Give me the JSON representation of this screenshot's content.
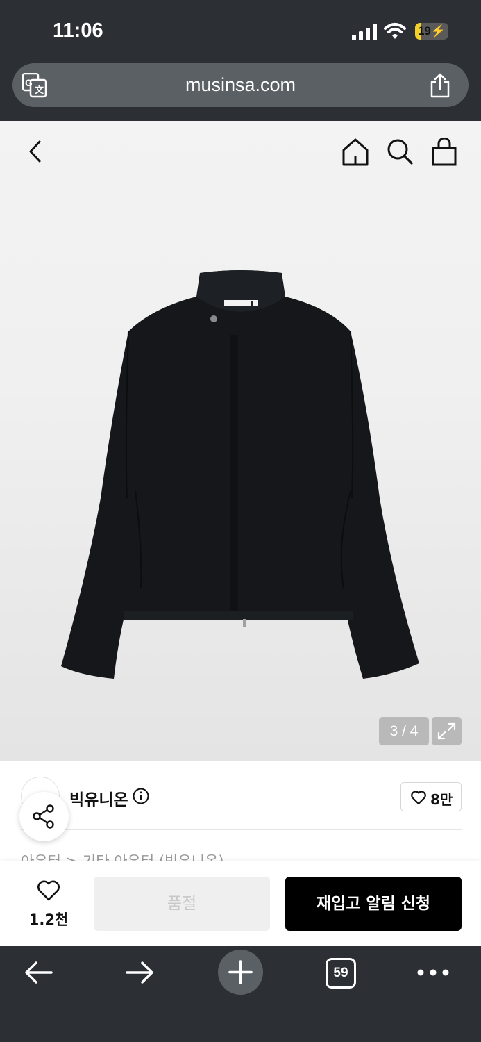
{
  "status_bar": {
    "time": "11:06",
    "battery_level": "19",
    "battery_fraction": 0.19,
    "charging": true,
    "battery_color": "#f4d12a"
  },
  "browser": {
    "url": "musinsa.com",
    "tab_count": "59"
  },
  "product": {
    "image_counter": "3 / 4",
    "brand_name": "빅유니온",
    "brand_likes": "8만",
    "breadcrumb": "아우터 > 기타 아우터 (빅유니온)"
  },
  "purchase_bar": {
    "wish_count": "1.2천",
    "soldout_label": "품절",
    "restock_label": "재입고 알림 신청"
  },
  "icons": {
    "translate": "translate-icon",
    "share": "share-icon",
    "back": "chevron-left-icon",
    "home": "home-icon",
    "search": "search-icon",
    "bag": "shopping-bag-icon",
    "expand": "expand-icon",
    "info": "info-icon",
    "heart": "heart-icon",
    "nav_back": "arrow-left-icon",
    "nav_forward": "arrow-right-icon",
    "new_tab": "plus-icon",
    "more": "more-dots-icon"
  }
}
